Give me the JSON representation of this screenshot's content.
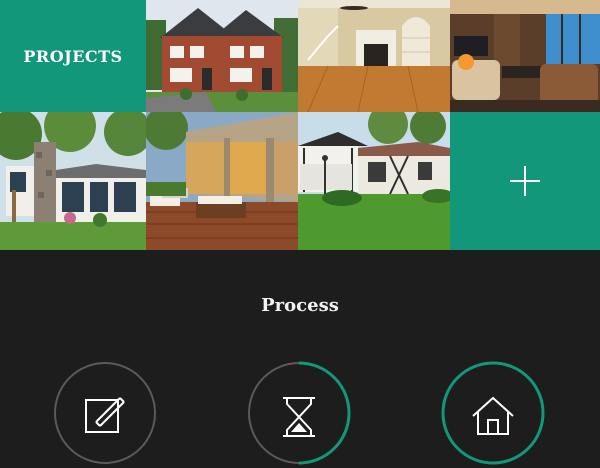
{
  "header": {
    "projects_label": "PROJECTS"
  },
  "gallery": {
    "tiles": [
      {
        "name": "brick-townhouse-photo"
      },
      {
        "name": "wood-floor-living-room-photo"
      },
      {
        "name": "luxury-living-room-photo"
      },
      {
        "name": "stone-chimney-cottage-photo"
      },
      {
        "name": "wood-deck-patio-photo"
      },
      {
        "name": "ranch-house-photo"
      }
    ],
    "add_icon": "plus-icon"
  },
  "process": {
    "title": "Process",
    "steps": [
      {
        "icon": "edit-icon",
        "progress": 0
      },
      {
        "icon": "hourglass-icon",
        "progress": 0.5
      },
      {
        "icon": "home-icon",
        "progress": 1
      }
    ]
  },
  "colors": {
    "accent": "#13977a",
    "background": "#1d1d1d",
    "ring_inactive": "#5a5a5a"
  }
}
